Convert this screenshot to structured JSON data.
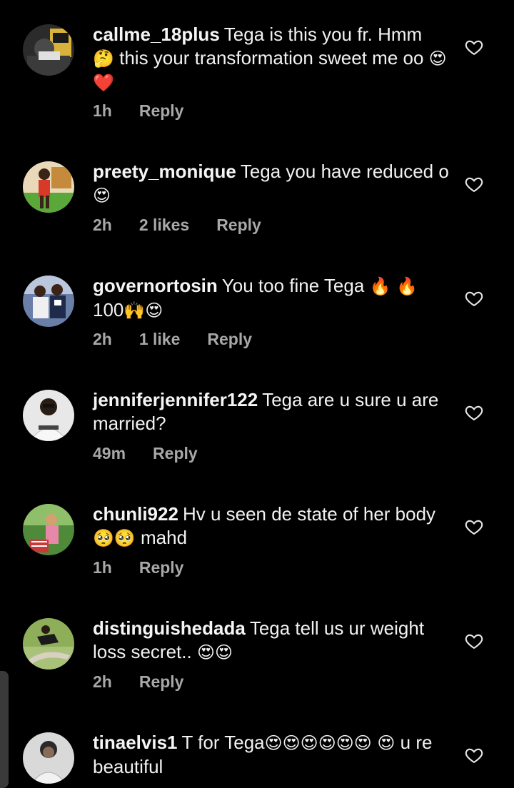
{
  "comments": [
    {
      "username": "callme_18plus",
      "text": "Tega is this you fr. Hmm",
      "text2": "this your transformation sweet me oo",
      "emoji_a": "🤔",
      "emoji_b": "😍❤️",
      "time": "1h",
      "likes": "",
      "reply": "Reply"
    },
    {
      "username": "preety_monique",
      "text": "Tega you have reduced o",
      "emoji_a": "😍",
      "time": "2h",
      "likes": "2 likes",
      "reply": "Reply"
    },
    {
      "username": "governortosin",
      "text": "You too fine Tega",
      "emoji_a": "🔥 🔥",
      "text2": "100",
      "emoji_b": "🙌😍",
      "time": "2h",
      "likes": "1 like",
      "reply": "Reply"
    },
    {
      "username": "jenniferjennifer122",
      "text": "Tega are u sure u are married?",
      "time": "49m",
      "likes": "",
      "reply": "Reply"
    },
    {
      "username": "chunli922",
      "text": "Hv u seen de state of her body",
      "emoji_a": "🥺🥺",
      "text2": "mahd",
      "time": "1h",
      "likes": "",
      "reply": "Reply"
    },
    {
      "username": "distinguishedada",
      "text": "Tega tell us ur weight loss secret..",
      "emoji_a": "😍😍",
      "time": "2h",
      "likes": "",
      "reply": "Reply"
    },
    {
      "username": "tinaelvis1",
      "text": "T for Tega",
      "emoji_a": "😍😍😍😍😍😍 😍",
      "text2": "u re beautiful",
      "time": "",
      "likes": "",
      "reply": ""
    }
  ],
  "icons": {
    "like": "heart-outline-icon"
  },
  "colors": {
    "background": "#000000",
    "text": "#f5f5f5",
    "meta": "#a8a8a8"
  }
}
